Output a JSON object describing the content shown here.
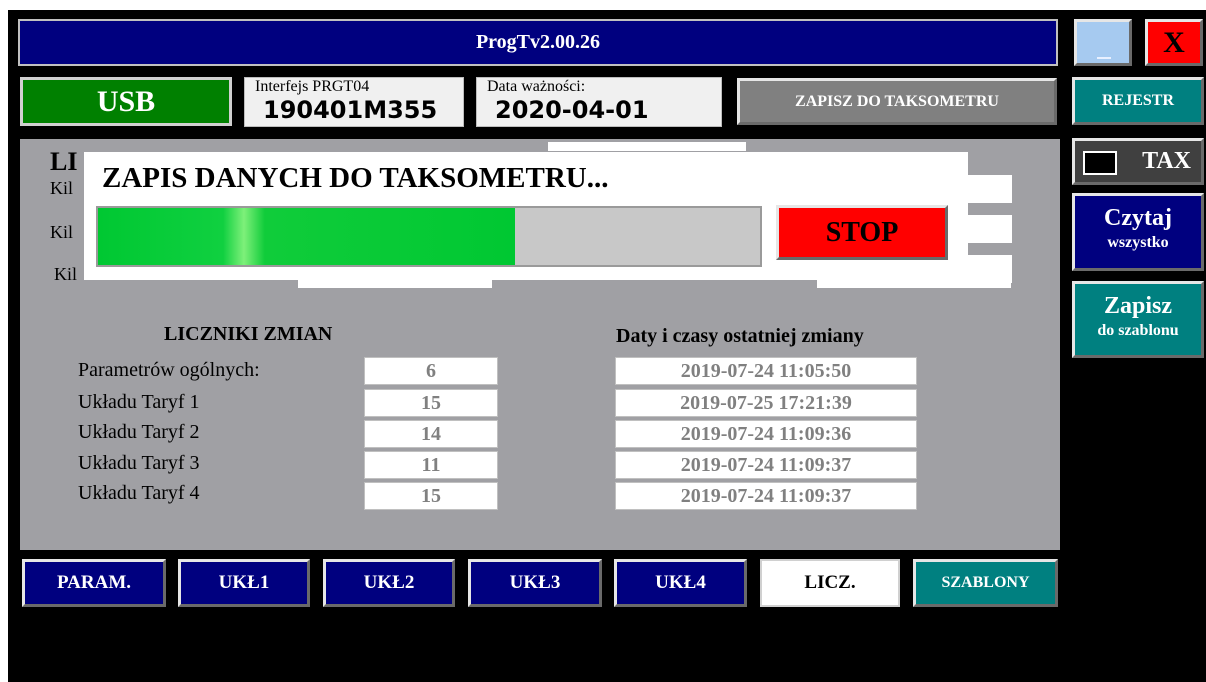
{
  "window": {
    "title": "ProgTv2.00.26",
    "close_label": "X"
  },
  "status": {
    "connection": "USB",
    "interface_label": "Interfejs PRGT04",
    "interface_value": "190401M355",
    "validity_label": "Data ważności:",
    "validity_value": "2020-04-01",
    "write_button": "ZAPISZ DO TAKSOMETRU"
  },
  "background": {
    "heading_fragment": "LI",
    "row_fragments": [
      "Kil",
      "Kil",
      "Kil"
    ]
  },
  "dialog": {
    "title": "ZAPIS DANYCH DO TAKSOMETRU...",
    "progress": 0.63,
    "stop_label": "STOP"
  },
  "counters": {
    "title": "LICZNIKI ZMIAN",
    "dates_title": "Daty i czasy ostatniej zmiany",
    "rows": [
      {
        "label": "Parametrów ogólnych:",
        "count": "6",
        "date": "2019-07-24 11:05:50"
      },
      {
        "label": "Układu Taryf 1",
        "count": "15",
        "date": "2019-07-25 17:21:39"
      },
      {
        "label": "Układu Taryf 2",
        "count": "14",
        "date": "2019-07-24 11:09:36"
      },
      {
        "label": "Układu Taryf 3",
        "count": "11",
        "date": "2019-07-24 11:09:37"
      },
      {
        "label": "Układu Taryf 4",
        "count": "15",
        "date": "2019-07-24 11:09:37"
      }
    ]
  },
  "tabs": {
    "param": "PARAM.",
    "ukl1": "UKŁ1",
    "ukl2": "UKŁ2",
    "ukl3": "UKŁ3",
    "ukl4": "UKŁ4",
    "licz": "LICZ.",
    "szablony": "SZABLONY"
  },
  "side": {
    "rejestr": "REJESTR",
    "tax": "TAX",
    "czytaj_line1": "Czytaj",
    "czytaj_line2": "wszystko",
    "zapisz_line1": "Zapisz",
    "zapisz_line2": "do szablonu"
  },
  "colors": {
    "title_bar": "#00007f",
    "usb_green": "#008000",
    "stop_red": "#ff0000",
    "teal": "#008080",
    "panel_gray": "#a0a0a4"
  }
}
